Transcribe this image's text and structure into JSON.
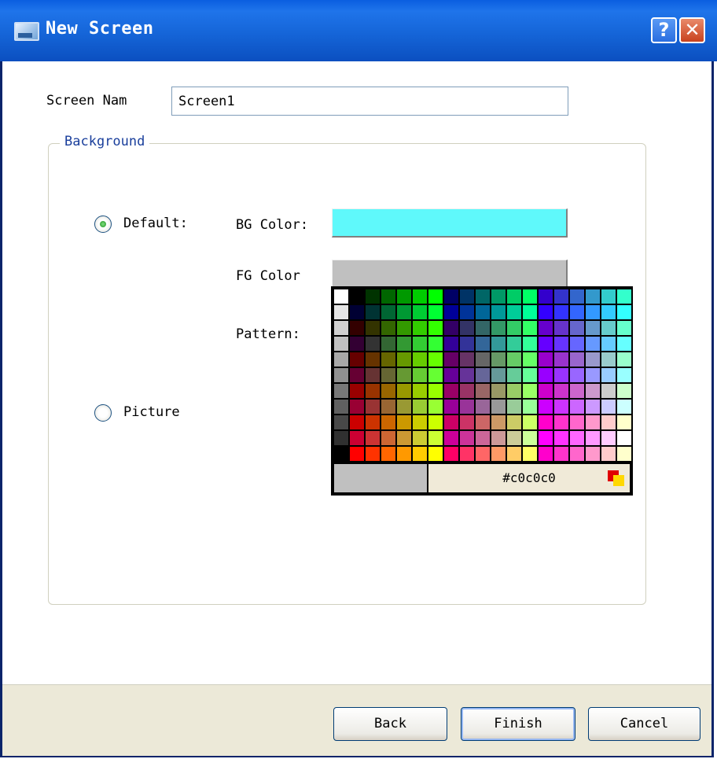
{
  "window": {
    "title": "New Screen",
    "help_glyph": "?",
    "close_glyph": "✕"
  },
  "form": {
    "screen_name_label": "Screen Nam",
    "screen_name_value": "Screen1"
  },
  "background_group": {
    "legend": "Background",
    "default_label": "Default:",
    "picture_label": "Picture",
    "bg_color_label": "BG Color:",
    "fg_color_label": "FG Color",
    "pattern_label": "Pattern:",
    "bg_color_value": "#5ff9fb",
    "fg_color_value": "#c0c0c0",
    "selected_option": "Default"
  },
  "color_picker": {
    "hex_value": "#c0c0c0",
    "preview_color": "#c0c0c0"
  },
  "buttons": {
    "back": "Back",
    "finish": "Finish",
    "cancel": "Cancel"
  }
}
